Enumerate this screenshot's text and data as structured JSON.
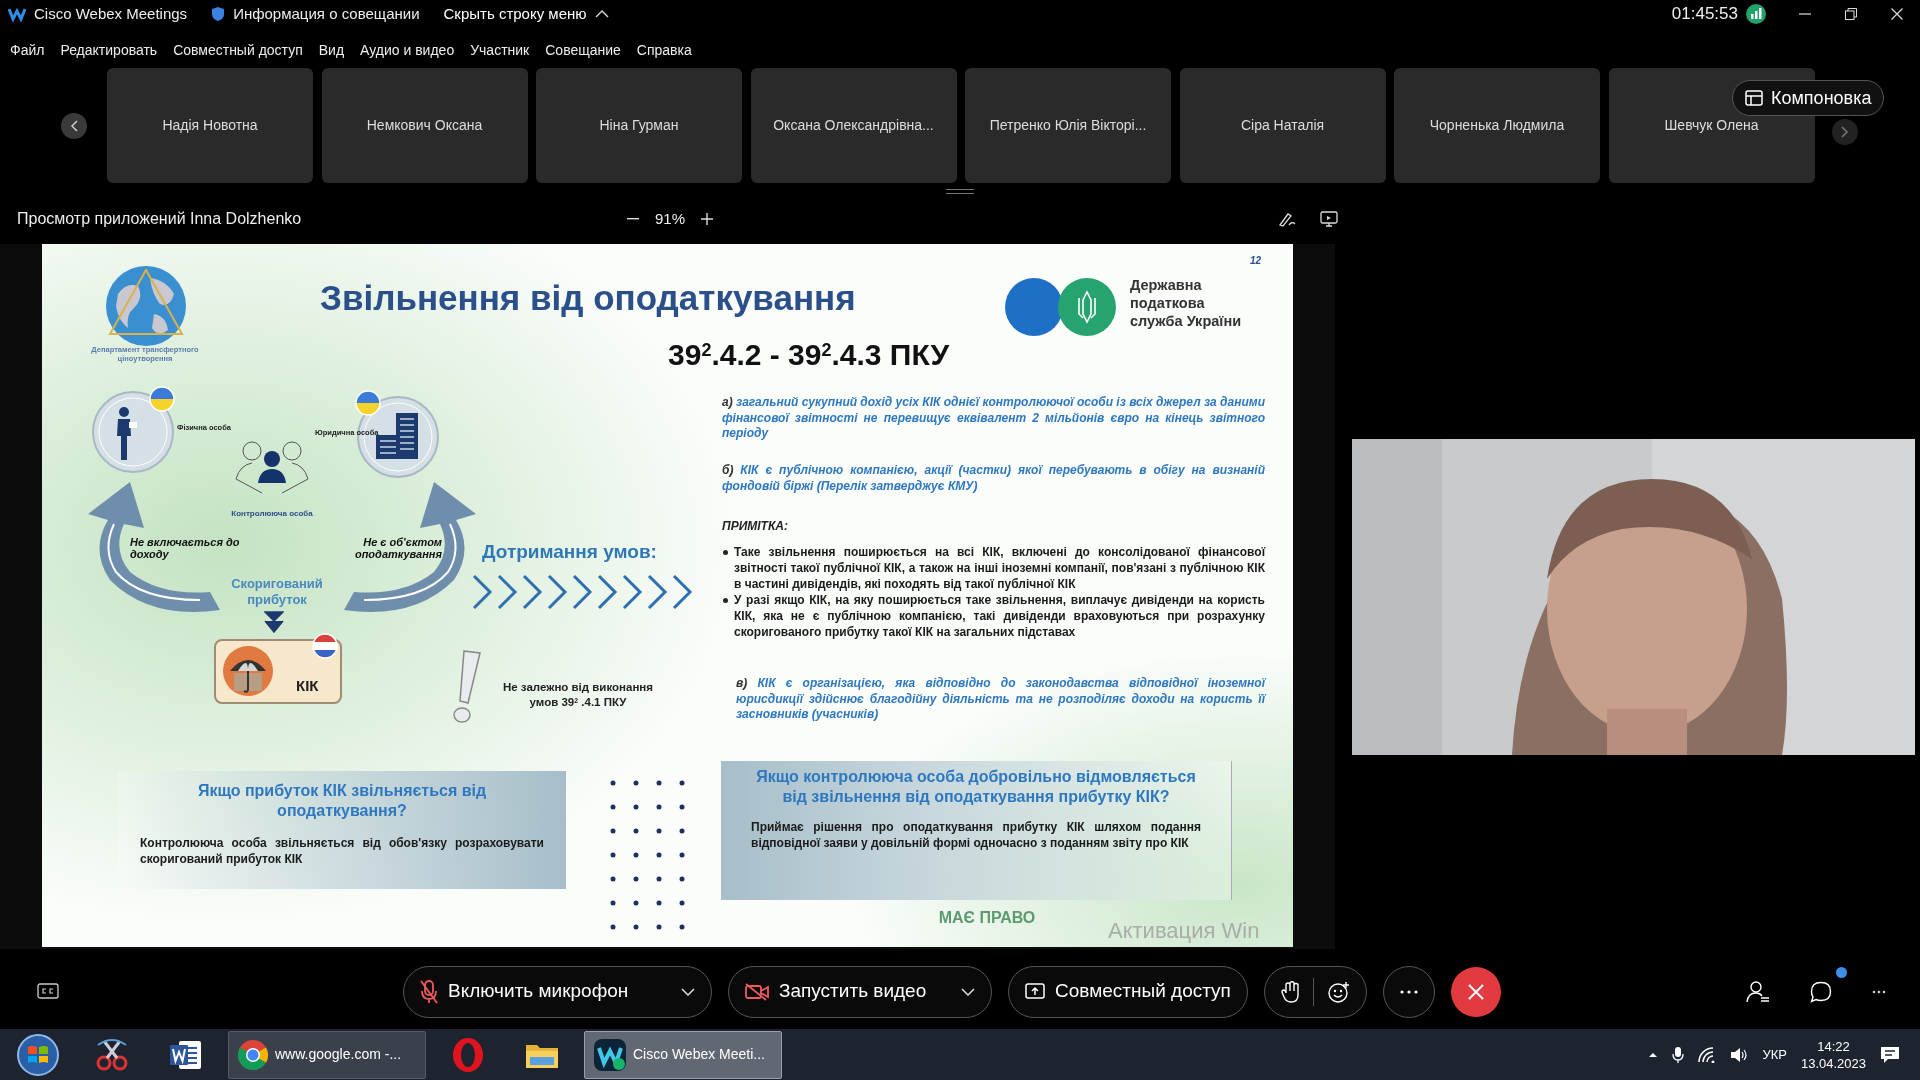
{
  "titlebar": {
    "app": "Cisco Webex Meetings",
    "meeting_info": "Информация о совещании",
    "hide_menu": "Скрыть строку меню",
    "time": "01:45:53"
  },
  "menu": [
    "Файл",
    "Редактировать",
    "Совместный доступ",
    "Вид",
    "Аудио и видео",
    "Участник",
    "Совещание",
    "Справка"
  ],
  "participants": [
    {
      "name": "Надія Новотна"
    },
    {
      "name": "Немкович Оксана"
    },
    {
      "name": "Ніна Гурман"
    },
    {
      "name": "Оксана Олександрівна..."
    },
    {
      "name": "Петренко Юлія Вікторі..."
    },
    {
      "name": "Сіра Наталія"
    },
    {
      "name": "Чорненька Людмила"
    },
    {
      "name": "Шевчук Олена"
    }
  ],
  "layout_button": "Компоновка",
  "share": {
    "title": "Просмотр приложений Inna Dolzhenko",
    "zoom": "91%"
  },
  "slide": {
    "page": "12",
    "title": "Звільнення від оподаткування",
    "department": "Департамент трансфертного ціноутворення",
    "agency": [
      "Державна",
      "податкова",
      "служба України"
    ],
    "articles": "39$^{2}$.4.2 - 39$^{2}$.4.3 ПКУ",
    "conditions": [
      {
        "marker": "а)",
        "text": "загальний сукупний дохід усіх КІК однієї контролюючої особи із всіх джерел за даними фінансової звітності не перевищує еквівалент 2 мільйонів євро на кінець звітного періоду"
      },
      {
        "marker": "б)",
        "text": "КІК є публічною компанією, акції (частки) якої перебувають в обігу на визнаній фондовій біржі (Перелік затверджує КМУ)"
      }
    ],
    "note_heading": "ПРИМІТКА:",
    "notes": [
      "Таке звільнення поширюється на всі КІК, включені до консолідованої фінансової звітності такої публічної КІК, а також на інші іноземні компанії, пов'язані з публічною КІК в частині дивідендів, які походять від такої публічної КІК",
      "У разі якщо КІК, на яку поширюється таке звільнення, виплачує дивіденди на користь КІК, яка не є публічною компанією, такі дивіденди враховуються при розрахунку скоригованого прибутку такої КІК на загальних підставах"
    ],
    "last_condition": {
      "marker": "в)",
      "text": "КІК є організацією, яка відповідно до законодавства відповідної іноземної юрисдикції здійснює благодійну діяльність та не розподіляє доходи на користь її засновників (учасників)"
    },
    "diagram": {
      "individual": "Фізична особа",
      "legal_entity": "Юридична особа",
      "controller": "Контролююча особа",
      "left_arrow": "Не включається до доходу",
      "right_arrow": "Не є об'єктом оподаткування",
      "adjusted_profit": "Скоригований прибуток",
      "cfc": "КІК"
    },
    "compliance": "Дотримання умов:",
    "regardless": "Не залежно від виконання умов 39$^{2}$ .4.1 ПКУ",
    "box_left": {
      "title": "Якщо прибуток КІК звільняється від оподаткування?",
      "text": "Контролююча особа звільняється від обов'язку розраховувати скоригований прибуток КІК"
    },
    "box_right": {
      "title": "Якщо контролююча особа добровільно відмовляється від звільнення від оподаткування прибутку КІК?",
      "text": "Приймає рішення про оподаткування прибутку КІК шляхом подання відповідної заяви у довільній формі одночасно з поданням звіту про КІК"
    },
    "right_label": "МАЄ ПРАВО",
    "os_notice": "Активация Win"
  },
  "controls": {
    "mic": "Включить микрофон",
    "video": "Запустить видео",
    "share": "Совместный доступ"
  },
  "chat": {
    "unread": true
  },
  "taskbar": {
    "apps": [
      {
        "kind": "start"
      },
      {
        "kind": "snip"
      },
      {
        "kind": "word"
      },
      {
        "kind": "chrome",
        "label": "www.google.com -...",
        "selected": false
      },
      {
        "kind": "opera"
      },
      {
        "kind": "explorer"
      },
      {
        "kind": "webex",
        "label": "Cisco Webex Meeti...",
        "selected": true
      }
    ],
    "lang": "УКР",
    "time": "14:22",
    "date": "13.04.2023"
  }
}
